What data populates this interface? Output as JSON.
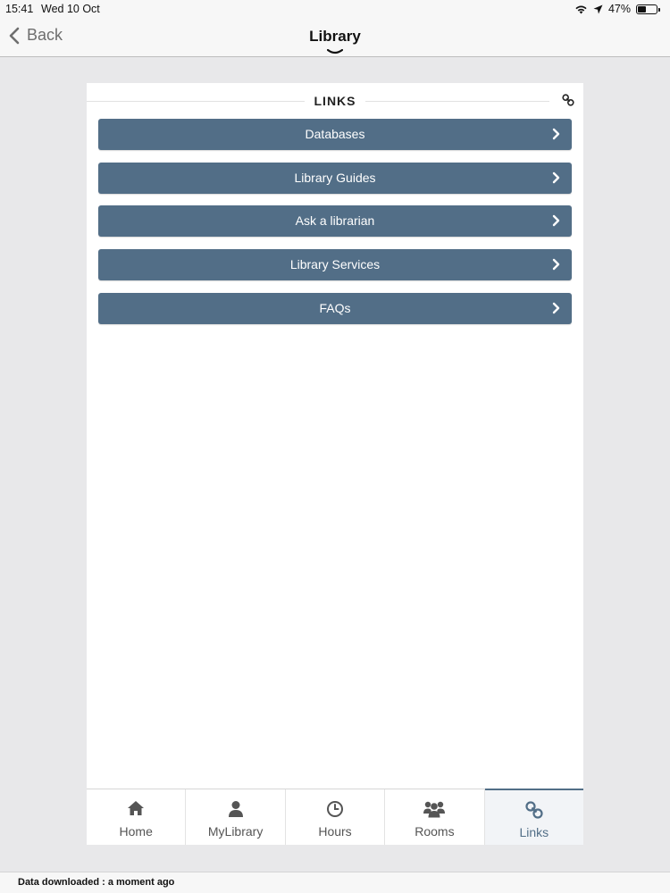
{
  "status_bar": {
    "time": "15:41",
    "date": "Wed 10 Oct",
    "battery_text": "47%",
    "battery_level": 0.47
  },
  "nav": {
    "back_label": "Back",
    "title": "Library"
  },
  "section": {
    "title": "LINKS",
    "icon": "link-icon"
  },
  "links": [
    {
      "label": "Databases"
    },
    {
      "label": "Library Guides"
    },
    {
      "label": "Ask a librarian"
    },
    {
      "label": "Library Services"
    },
    {
      "label": "FAQs"
    }
  ],
  "tabs": [
    {
      "label": "Home",
      "icon": "home-icon"
    },
    {
      "label": "MyLibrary",
      "icon": "user-icon"
    },
    {
      "label": "Hours",
      "icon": "clock-icon"
    },
    {
      "label": "Rooms",
      "icon": "group-icon"
    },
    {
      "label": "Links",
      "icon": "link-icon",
      "active": true
    }
  ],
  "footer": {
    "status": "Data downloaded : a moment ago"
  },
  "colors": {
    "accent": "#526e87",
    "background": "#e8e8ea",
    "panel": "#ffffff"
  }
}
